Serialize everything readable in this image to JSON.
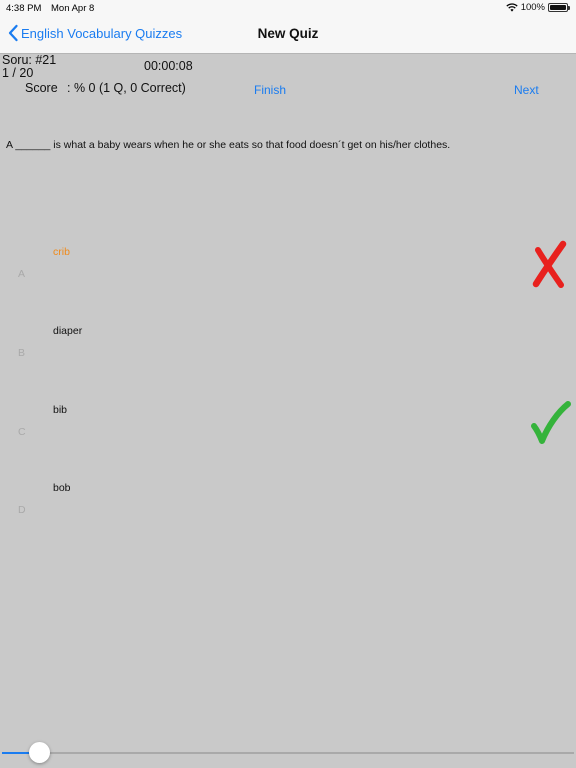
{
  "status": {
    "time": "4:38 PM",
    "date": "Mon Apr 8",
    "battery": "100%"
  },
  "nav": {
    "back_label": "English Vocabulary Quizzes",
    "title": "New Quiz"
  },
  "quiz": {
    "question_id": "Soru: #21",
    "progress": "1 / 20",
    "timer": "00:00:08",
    "score_label": "Score",
    "score_value": ": % 0 (1 Q, 0 Correct)",
    "finish_label": "Finish",
    "next_label": "Next",
    "question": "A ______ is what a baby wears when he or she eats so that food doesn´t get on his/her clothes.",
    "choices": [
      {
        "letter": "A",
        "text": "crib",
        "state": "wrong"
      },
      {
        "letter": "B",
        "text": "diaper",
        "state": "none"
      },
      {
        "letter": "C",
        "text": "bib",
        "state": "correct"
      },
      {
        "letter": "D",
        "text": "bob",
        "state": "none"
      }
    ]
  },
  "progress_slider": {
    "value": 0.05
  },
  "colors": {
    "accent": "#1a7cf0",
    "wrong_mark": "#e8211e",
    "correct_mark": "#35b33b",
    "selected_text": "#f08a1a",
    "background": "#c9c9c9"
  },
  "icons": {
    "back": "chevron-left-icon",
    "wifi": "wifi-icon",
    "battery": "battery-icon",
    "wrong": "cross-mark-icon",
    "correct": "check-mark-icon"
  }
}
